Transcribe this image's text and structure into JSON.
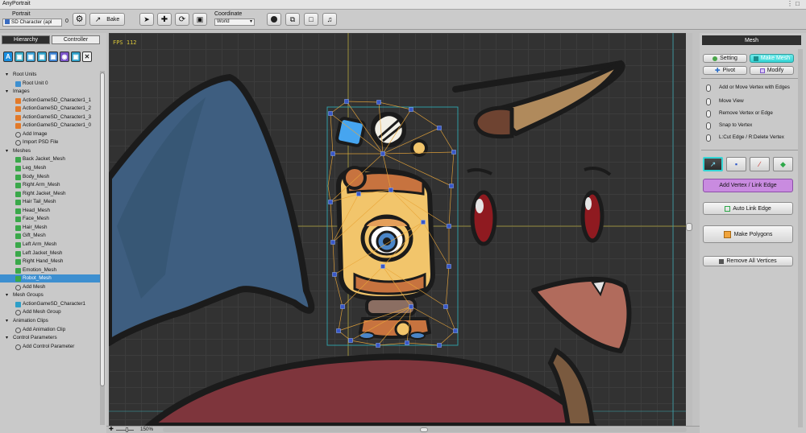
{
  "window": {
    "tab_title": "AnyPortrait"
  },
  "toolbar": {
    "portrait_label": "Portrait",
    "portrait_value": "SD Character (apl",
    "portrait_count": "0",
    "bake_label": "Bake",
    "coordinate_label": "Coordinate",
    "coordinate_value": "World"
  },
  "left_panel": {
    "tabs": [
      "Hierarchy",
      "Controller"
    ],
    "icon_colors": [
      "#1a8fe0",
      "#35a7c3",
      "#3b9fd4",
      "#2e9fc8",
      "#3a7fd0",
      "#7b55c9",
      "#2e9fc8",
      "#f0f0f0"
    ],
    "tree": [
      {
        "kind": "header",
        "label": "Root Units"
      },
      {
        "kind": "item",
        "label": "Root Unit 0",
        "icon": "root-icon"
      },
      {
        "kind": "header",
        "label": "Images"
      },
      {
        "kind": "item",
        "label": "ActionGameSD_Character1_1",
        "icon": "image-icon"
      },
      {
        "kind": "item",
        "label": "ActionGameSD_Character1_2",
        "icon": "image-icon"
      },
      {
        "kind": "item",
        "label": "ActionGameSD_Character1_3",
        "icon": "image-icon"
      },
      {
        "kind": "item",
        "label": "ActionGameSD_Character1_0",
        "icon": "image-icon"
      },
      {
        "kind": "item",
        "label": "Add Image",
        "icon": "add-icon"
      },
      {
        "kind": "item",
        "label": "Import PSD File",
        "icon": "add-icon"
      },
      {
        "kind": "header",
        "label": "Meshes"
      },
      {
        "kind": "item",
        "label": "Back Jacket_Mesh",
        "icon": "mesh-icon"
      },
      {
        "kind": "item",
        "label": "Leg_Mesh",
        "icon": "mesh-icon"
      },
      {
        "kind": "item",
        "label": "Body_Mesh",
        "icon": "mesh-icon"
      },
      {
        "kind": "item",
        "label": "Right Arm_Mesh",
        "icon": "mesh-icon"
      },
      {
        "kind": "item",
        "label": "Right Jacket_Mesh",
        "icon": "mesh-icon"
      },
      {
        "kind": "item",
        "label": "Hair Tail_Mesh",
        "icon": "mesh-icon"
      },
      {
        "kind": "item",
        "label": "Head_Mesh",
        "icon": "mesh-icon"
      },
      {
        "kind": "item",
        "label": "Face_Mesh",
        "icon": "mesh-icon"
      },
      {
        "kind": "item",
        "label": "Hair_Mesh",
        "icon": "mesh-icon"
      },
      {
        "kind": "item",
        "label": "Gift_Mesh",
        "icon": "mesh-icon"
      },
      {
        "kind": "item",
        "label": "Left Arm_Mesh",
        "icon": "mesh-icon"
      },
      {
        "kind": "item",
        "label": "Left Jacket_Mesh",
        "icon": "mesh-icon"
      },
      {
        "kind": "item",
        "label": "Right Hand_Mesh",
        "icon": "mesh-icon"
      },
      {
        "kind": "item",
        "label": "Emotion_Mesh",
        "icon": "mesh-icon"
      },
      {
        "kind": "item",
        "label": "Robot_Mesh",
        "icon": "mesh-icon",
        "selected": true
      },
      {
        "kind": "item",
        "label": "Add Mesh",
        "icon": "add-icon"
      },
      {
        "kind": "header",
        "label": "Mesh Groups"
      },
      {
        "kind": "item",
        "label": "ActionGameSD_Character1",
        "icon": "mesh-group-icon"
      },
      {
        "kind": "item",
        "label": "Add Mesh Group",
        "icon": "add-icon"
      },
      {
        "kind": "header",
        "label": "Animation Clips"
      },
      {
        "kind": "item",
        "label": "Add Animation Clip",
        "icon": "add-icon"
      },
      {
        "kind": "header",
        "label": "Control Parameters"
      },
      {
        "kind": "item",
        "label": "Add Control Parameter",
        "icon": "add-icon"
      }
    ]
  },
  "viewport": {
    "fps": "FPS 112",
    "zoom": "150%"
  },
  "right_panel": {
    "title": "Mesh",
    "setting_label": "Setting",
    "make_mesh_label": "Make Mesh",
    "pivot_label": "Pivot",
    "modify_label": "Modify",
    "instructions": [
      "Add or Move Vertex with Edges",
      "Move View",
      "Remove Vertex or Edge",
      "Snap to Vertex",
      "L:Cut Edge / R:Delete Vertex"
    ],
    "add_vertex_label": "Add Vertex / Link Edge",
    "auto_link_label": "Auto Link Edge",
    "make_polygons_label": "Make Polygons",
    "remove_all_label": "Remove All Vertices"
  },
  "colors": {
    "accent_cyan": "#35d6d6",
    "selection_blue": "#3d8fd0",
    "add_vertex_purple": "#c98be0",
    "canvas_bg": "#323232"
  }
}
